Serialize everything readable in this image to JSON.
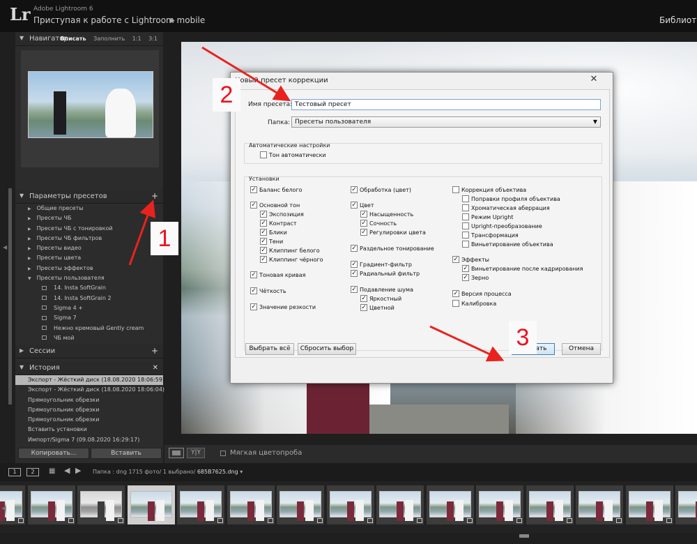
{
  "app": {
    "logo": "Lr",
    "name": "Adobe Lightroom 6",
    "subtitle": "Приступая к работе с Lightroom mobile",
    "module": "Библиотек"
  },
  "left_panel": {
    "navigator": {
      "title": "Навигатор",
      "options": [
        "Вписать",
        "Заполнить",
        "1:1",
        "3:1"
      ],
      "selected": "Вписать"
    },
    "presets": {
      "title": "Параметры пресетов",
      "groups": [
        "Общие пресеты",
        "Пресеты ЧБ",
        "Пресеты ЧБ с тонировкой",
        "Пресеты ЧБ фильтров",
        "Пресеты видео",
        "Пресеты цвета",
        "Пресеты эффектов",
        "Пресеты пользователя"
      ],
      "user_presets": [
        "14. Insta SoftGrain",
        "14. Insta SoftGrain 2",
        "Sigma 4 +",
        "Sigma 7",
        "Нежно кремовый Gently cream",
        "ЧБ мой"
      ]
    },
    "sessions": {
      "title": "Сессии"
    },
    "history": {
      "title": "История",
      "items": [
        "Экспорт - Жёсткий диск (18.08.2020 18:06:59)",
        "Экспорт - Жёсткий диск (18.08.2020 18:06:04)",
        "Прямоугольник обрезки",
        "Прямоугольник обрезки",
        "Прямоугольник обрезки",
        "Вставить установки",
        "Импорт/Sigma 7 (09.08.2020 16:29:17)"
      ]
    },
    "copy_label": "Копировать...",
    "paste_label": "Вставить"
  },
  "toolbar": {
    "yy": "Y|Y",
    "soft_proof": "Мягкая цветопроба"
  },
  "filmstrip": {
    "page1": "1",
    "page2": "2",
    "path": "Папка : dng",
    "count": "1715 фото/",
    "selected": "1 выбрано/",
    "filename": "685B7625.dng",
    "frame_count": 15,
    "selected_index": 3
  },
  "dialog": {
    "title": "Новый пресет коррекции",
    "close": "✕",
    "name_label": "Имя пресета:",
    "name_value": "Тестовый пресет",
    "folder_label": "Папка:",
    "folder_value": "Пресеты пользователя",
    "auto_group": "Автоматические настройки",
    "auto_tone": "Тон автоматически",
    "settings_group": "Установки",
    "col1": [
      {
        "label": "Баланс белого",
        "checked": true
      },
      {
        "label": "Основной тон",
        "checked": true
      },
      {
        "label": "Экспозиция",
        "checked": true
      },
      {
        "label": "Контраст",
        "checked": true
      },
      {
        "label": "Блики",
        "checked": true
      },
      {
        "label": "Тени",
        "checked": true
      },
      {
        "label": "Клиппинг белого",
        "checked": true
      },
      {
        "label": "Клиппинг чёрного",
        "checked": true
      },
      {
        "label": "Тоновая кривая",
        "checked": true
      },
      {
        "label": "Чёткость",
        "checked": true
      },
      {
        "label": "Значение резкости",
        "checked": true
      }
    ],
    "col2": [
      {
        "label": "Обработка (цвет)",
        "checked": true
      },
      {
        "label": "Цвет",
        "checked": true
      },
      {
        "label": "Насыщенность",
        "checked": true
      },
      {
        "label": "Сочность",
        "checked": true
      },
      {
        "label": "Регулировки цвета",
        "checked": true
      },
      {
        "label": "Раздельное тонирование",
        "checked": true
      },
      {
        "label": "Градиент-фильтр",
        "checked": true
      },
      {
        "label": "Радиальный фильтр",
        "checked": true
      },
      {
        "label": "Подавление шума",
        "checked": true
      },
      {
        "label": "Яркостный",
        "checked": true
      },
      {
        "label": "Цветной",
        "checked": true
      }
    ],
    "col3": [
      {
        "label": "Коррекция объектива",
        "checked": false
      },
      {
        "label": "Поправки профиля объектива",
        "checked": false
      },
      {
        "label": "Хроматическая аберрация",
        "checked": false
      },
      {
        "label": "Режим Upright",
        "checked": false
      },
      {
        "label": "Upright-преобразование",
        "checked": false
      },
      {
        "label": "Трансформация",
        "checked": false
      },
      {
        "label": "Виньетирование объектива",
        "checked": false
      },
      {
        "label": "Эффекты",
        "checked": true
      },
      {
        "label": "Виньетирование после кадрирования",
        "checked": true
      },
      {
        "label": "Зерно",
        "checked": true
      },
      {
        "label": "Версия процесса",
        "checked": true
      },
      {
        "label": "Калибровка",
        "checked": false
      }
    ],
    "select_all": "Выбрать всё",
    "reset": "Сбросить выбор",
    "create": "Создать",
    "cancel": "Отмена"
  },
  "annotations": [
    "1",
    "2",
    "3"
  ],
  "colors": {
    "arrow": "#e8231f",
    "highlight": "#3c7fb1"
  }
}
